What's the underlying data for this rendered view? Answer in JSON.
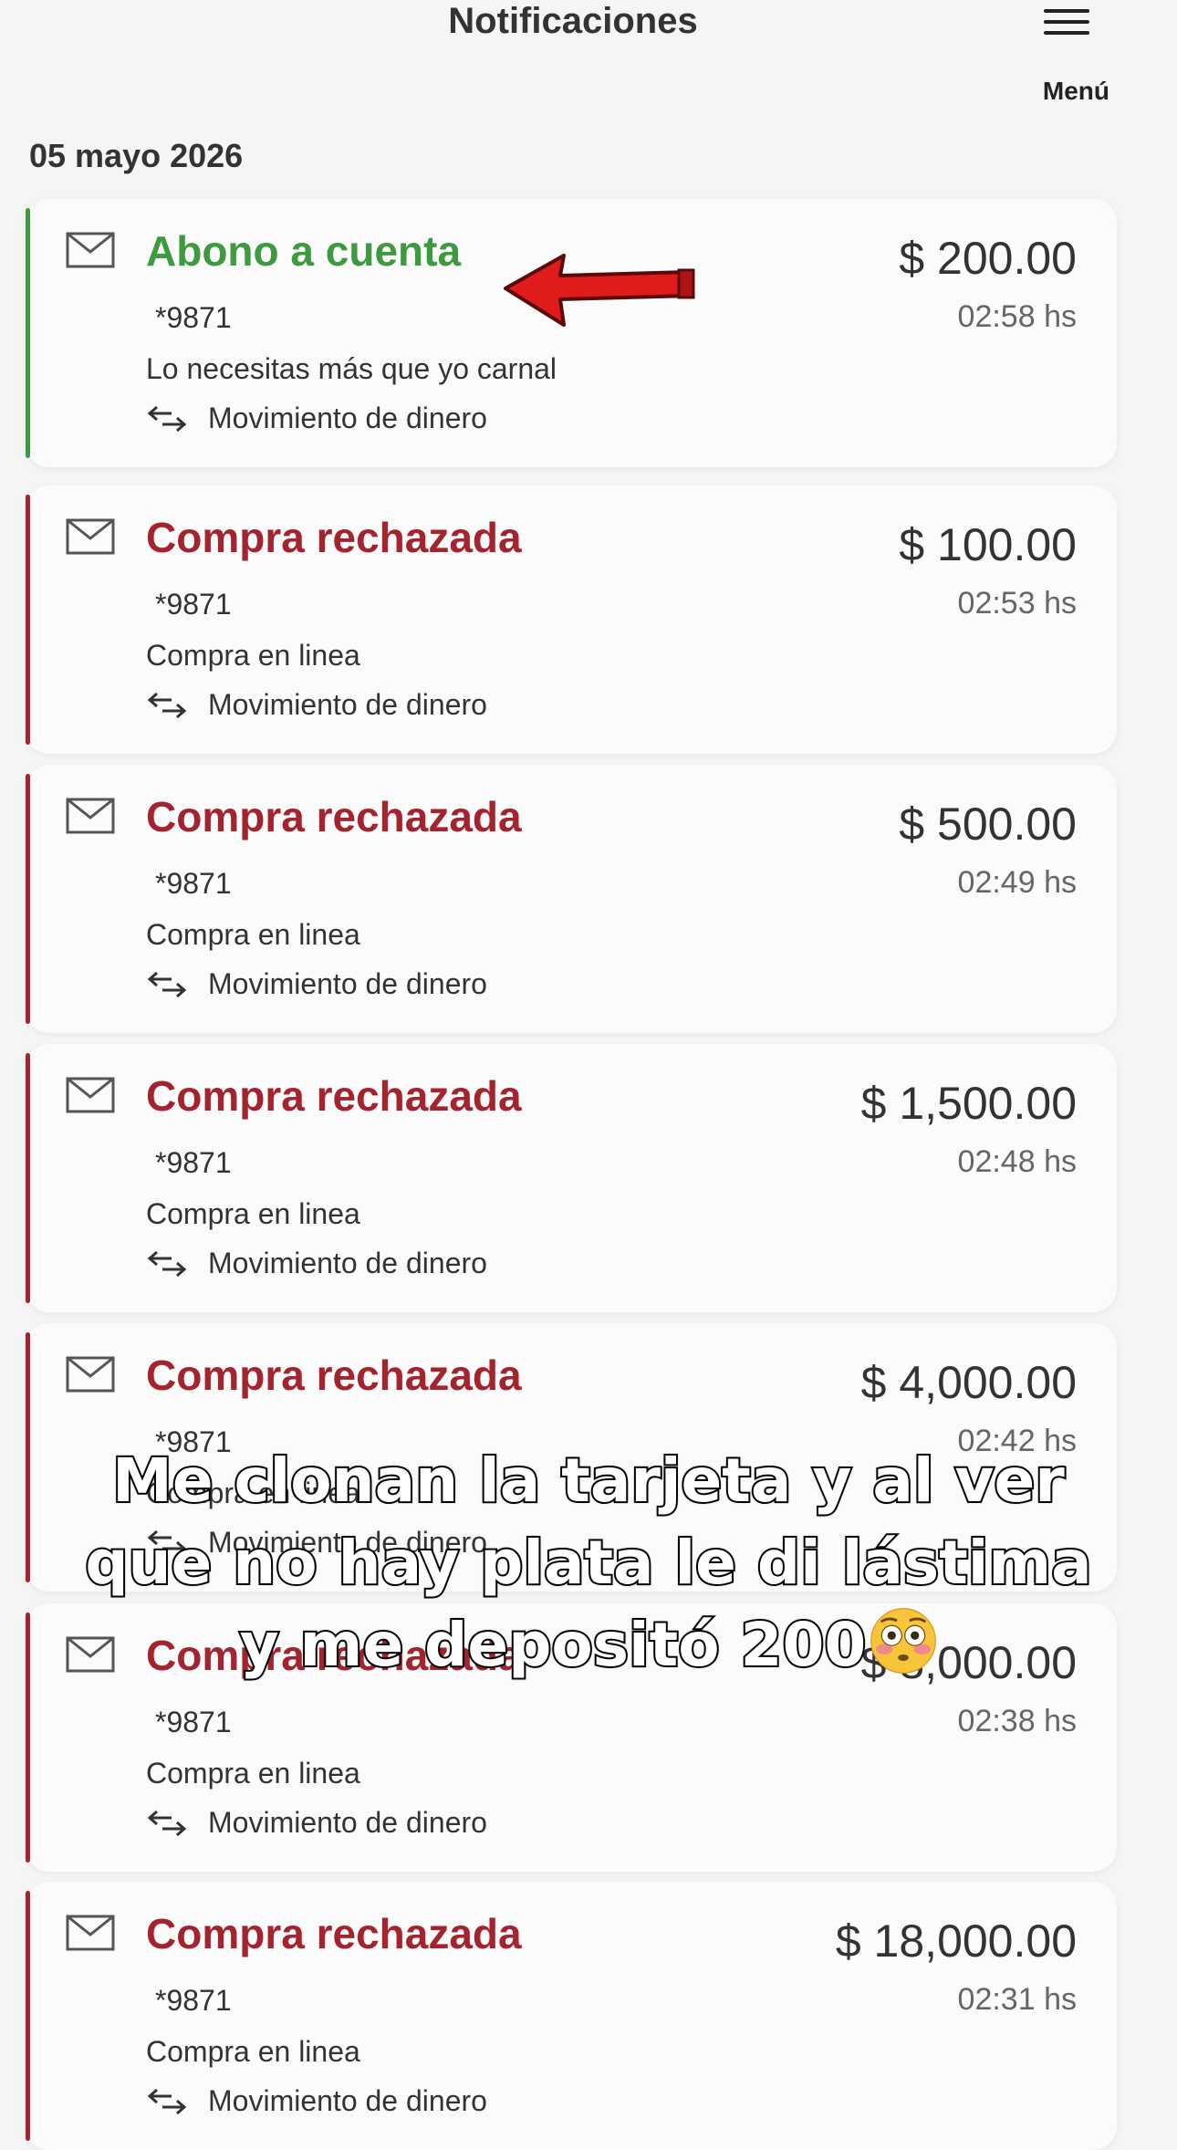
{
  "header": {
    "title": "Notificaciones",
    "menu_label": "Menú"
  },
  "date": "05 mayo 2026",
  "colors": {
    "credit": "#3d9a3f",
    "rejected": "#a3232f",
    "arrow": "#e01b1b"
  },
  "notifications": [
    {
      "title": "Abono a cuenta",
      "account": "*9871",
      "amount": "$ 200.00",
      "time": "02:58 hs",
      "description": "Lo necesitas más que yo carnal",
      "movement": "Movimiento de dinero",
      "status": "credit"
    },
    {
      "title": "Compra rechazada",
      "account": "*9871",
      "amount": "$ 100.00",
      "time": "02:53 hs",
      "description": "Compra en linea",
      "movement": "Movimiento de dinero",
      "status": "rejected"
    },
    {
      "title": "Compra rechazada",
      "account": "*9871",
      "amount": "$ 500.00",
      "time": "02:49 hs",
      "description": "Compra en linea",
      "movement": "Movimiento de dinero",
      "status": "rejected"
    },
    {
      "title": "Compra rechazada",
      "account": "*9871",
      "amount": "$ 1,500.00",
      "time": "02:48 hs",
      "description": "Compra en linea",
      "movement": "Movimiento de dinero",
      "status": "rejected"
    },
    {
      "title": "Compra rechazada",
      "account": "*9871",
      "amount": "$ 4,000.00",
      "time": "02:42 hs",
      "description": "Compra en linea",
      "movement": "Movimiento de dinero",
      "status": "rejected"
    },
    {
      "title": "Compra rechazada",
      "account": "*9871",
      "amount": "$ 8,000.00",
      "time": "02:38 hs",
      "description": "Compra en linea",
      "movement": "Movimiento de dinero",
      "status": "rejected"
    },
    {
      "title": "Compra rechazada",
      "account": "*9871",
      "amount": "$ 18,000.00",
      "time": "02:31 hs",
      "description": "Compra en linea",
      "movement": "Movimiento de dinero",
      "status": "rejected"
    }
  ],
  "caption": {
    "line1": "Me clonan la tarjeta y al ver",
    "line2": "que no hay plata le di lástima",
    "line3": "y me depositó 200",
    "emoji": "flushed-face-emoji"
  },
  "annotation": {
    "icon": "red-arrow-icon"
  }
}
